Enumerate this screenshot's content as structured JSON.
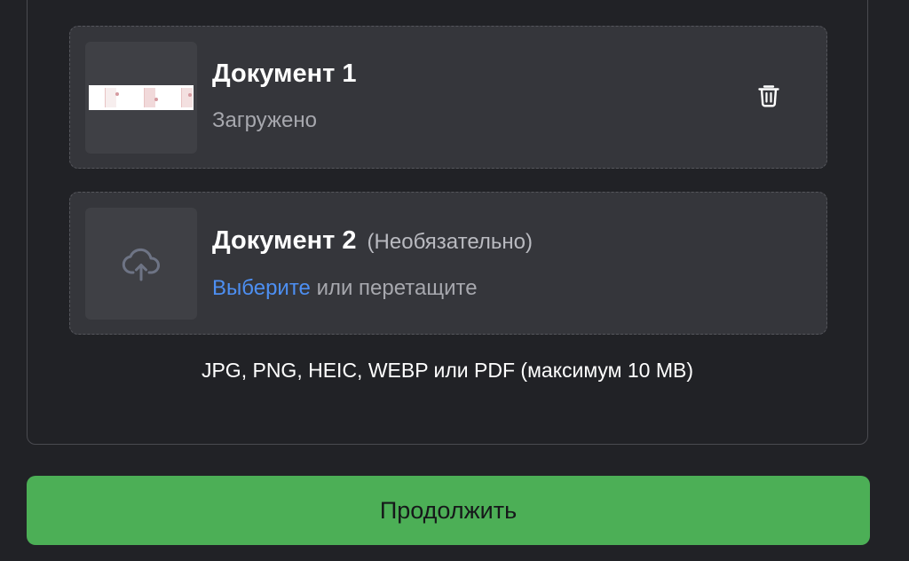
{
  "documents": [
    {
      "title": "Документ 1",
      "optional": "",
      "status": "Загружено",
      "state": "uploaded",
      "action_icon": "trash-icon",
      "preview_icon": "document-preview"
    },
    {
      "title": "Документ 2",
      "optional": "(Необязательно)",
      "select_link": "Выберите",
      "drag_text": " или перетащите",
      "state": "empty",
      "upload_icon": "cloud-upload-icon"
    }
  ],
  "formats_note": "JPG, PNG, HEIC, WEBP или PDF (максимум 10 MB)",
  "continue_label": "Продолжить",
  "colors": {
    "background": "#212226",
    "card": "#35363b",
    "accent_link": "#4d8ff2",
    "primary_button": "#4caf56"
  }
}
